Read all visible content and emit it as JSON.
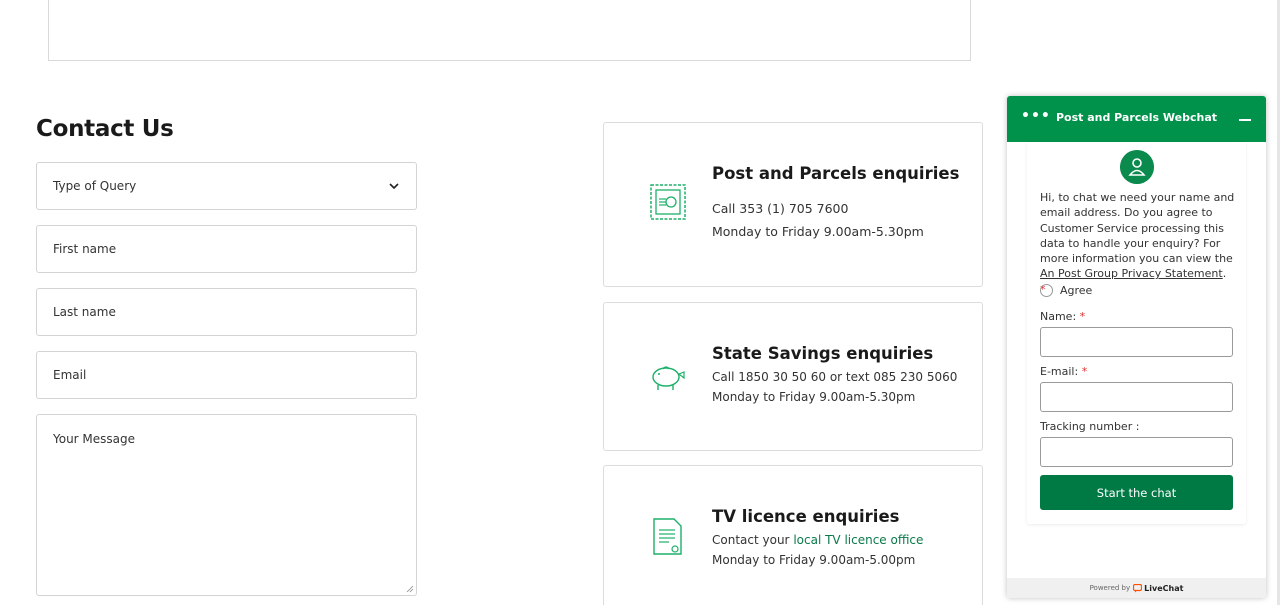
{
  "top_box": {
    "text": ""
  },
  "contact": {
    "title": "Contact Us",
    "type_of_query": "Type of Query",
    "first_name": "First name",
    "last_name": "Last name",
    "email": "Email",
    "message": "Your Message"
  },
  "cards": [
    {
      "title": "Post and Parcels enquiries",
      "line1": "Call 353 (1) 705 7600",
      "line2": "Monday to Friday 9.00am-5.30pm",
      "icon": "stamp-icon"
    },
    {
      "title": "State Savings enquiries",
      "line1": "Call 1850 30 50 60 or text 085 230 5060",
      "line2": "Monday to Friday 9.00am-5.30pm",
      "icon": "piggy-bank-icon"
    },
    {
      "title": "TV licence enquiries",
      "line1_prefix": "Contact your ",
      "line1_link": "local TV licence office",
      "line2": "Monday to Friday 9.00am-5.00pm",
      "icon": "certificate-icon"
    }
  ],
  "chat": {
    "title": "Post and Parcels Webchat",
    "dots": "•••",
    "intro": "Hi, to chat we need your name and email address. Do you agree to Customer Service processing this data to handle your enquiry? For more information you can view the ",
    "privacy_link": "An Post Group Privacy Statement",
    "intro_end": ".",
    "required_mark": "*",
    "agree": "Agree",
    "name_label": "Name:",
    "email_label": "E-mail:",
    "tracking_label": "Tracking number :",
    "start_button": "Start the chat",
    "powered_by": "Powered by",
    "livechat": "LiveChat"
  },
  "colors": {
    "brand_green": "#00914a",
    "button_green": "#007a45",
    "icon_green": "#1db06a",
    "required_red": "#d9302c"
  }
}
